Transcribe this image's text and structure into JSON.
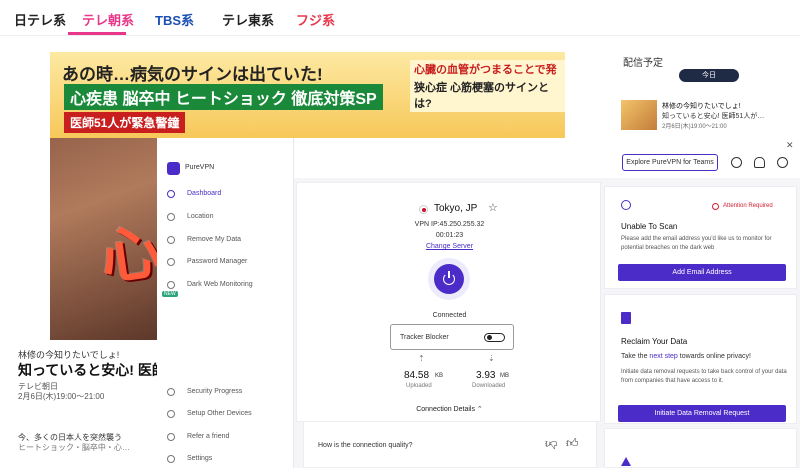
{
  "tv_nav": [
    {
      "label": "日テレ系",
      "active": false
    },
    {
      "label": "テレ朝系",
      "active": true
    },
    {
      "label": "TBS系",
      "active": false
    },
    {
      "label": "テレ東系",
      "active": false
    },
    {
      "label": "フジ系",
      "active": false
    }
  ],
  "hero": {
    "line1": "あの時…病気のサインは出ていた!",
    "line2": "心疾患 脳卒中 ヒートショック 徹底対策SP",
    "line3": "医師51人が緊急警鐘",
    "right1": "心臓の血管がつまることで発症",
    "right2": "狭心症 心筋梗塞のサインとは?",
    "big": "心臓"
  },
  "article": {
    "small": "林修の今知りたいでしょ!",
    "title": "知っていると安心! 医師51",
    "channel": "テレビ朝日",
    "time": "2月6日(木)19:00～21:00",
    "desc1": "今、多くの日本人を突然襲う",
    "desc2": "ヒートショック・脳卒中・心…"
  },
  "schedule": {
    "title": "配信予定",
    "today": "今日",
    "item_title": "林修の今知りたいでしょ!",
    "item_sub": "知っていると安心! 医師51人が…",
    "item_time": "2月6日(木)19:00～21:00"
  },
  "vpn": {
    "app_name": "PureVPN",
    "nav": [
      {
        "label": "Dashboard",
        "icon": "home-icon",
        "active": true
      },
      {
        "label": "Location",
        "icon": "globe-icon",
        "active": false
      },
      {
        "label": "Remove My Data",
        "icon": "eraser-icon",
        "active": false
      },
      {
        "label": "Password Manager",
        "icon": "key-icon",
        "active": false
      },
      {
        "label": "Dark Web Monitoring",
        "icon": "radar-icon",
        "active": false,
        "badge": "NEW"
      }
    ],
    "nav_bottom": [
      {
        "label": "Security Progress",
        "icon": "shield-icon"
      },
      {
        "label": "Setup Other Devices",
        "icon": "devices-icon"
      },
      {
        "label": "Refer a friend",
        "icon": "gift-icon"
      },
      {
        "label": "Settings",
        "icon": "gear-icon"
      }
    ],
    "explore_label": "Explore PureVPN for Teams",
    "location": "Tokyo, JP",
    "vpn_ip": "VPN IP:45.250.255.32",
    "timer": "00:01:23",
    "change_server": "Change Server",
    "status": "Connected",
    "tracker_label": "Tracker Blocker",
    "upload_value": "84.58",
    "upload_unit": "KB",
    "upload_label": "Uploaded",
    "download_value": "3.93",
    "download_unit": "MB",
    "download_label": "Downloaded",
    "connection_details": "Connection Details",
    "quality_question": "How is the connection quality?",
    "scan": {
      "attention": "Attention Required",
      "title": "Unable To Scan",
      "desc": "Please add the email address you'd like us to monitor for potential breaches on the dark web",
      "button": "Add Email Address"
    },
    "reclaim": {
      "title": "Reclaim Your Data",
      "sub_pre": "Take the",
      "sub_link": "next step",
      "sub_post": "towards online privacy!",
      "desc": "Initiate data removal requests to take back control of your data from companies that have access to it.",
      "button": "Initiate Data Removal Request"
    },
    "accent": "#4b2cc8"
  }
}
